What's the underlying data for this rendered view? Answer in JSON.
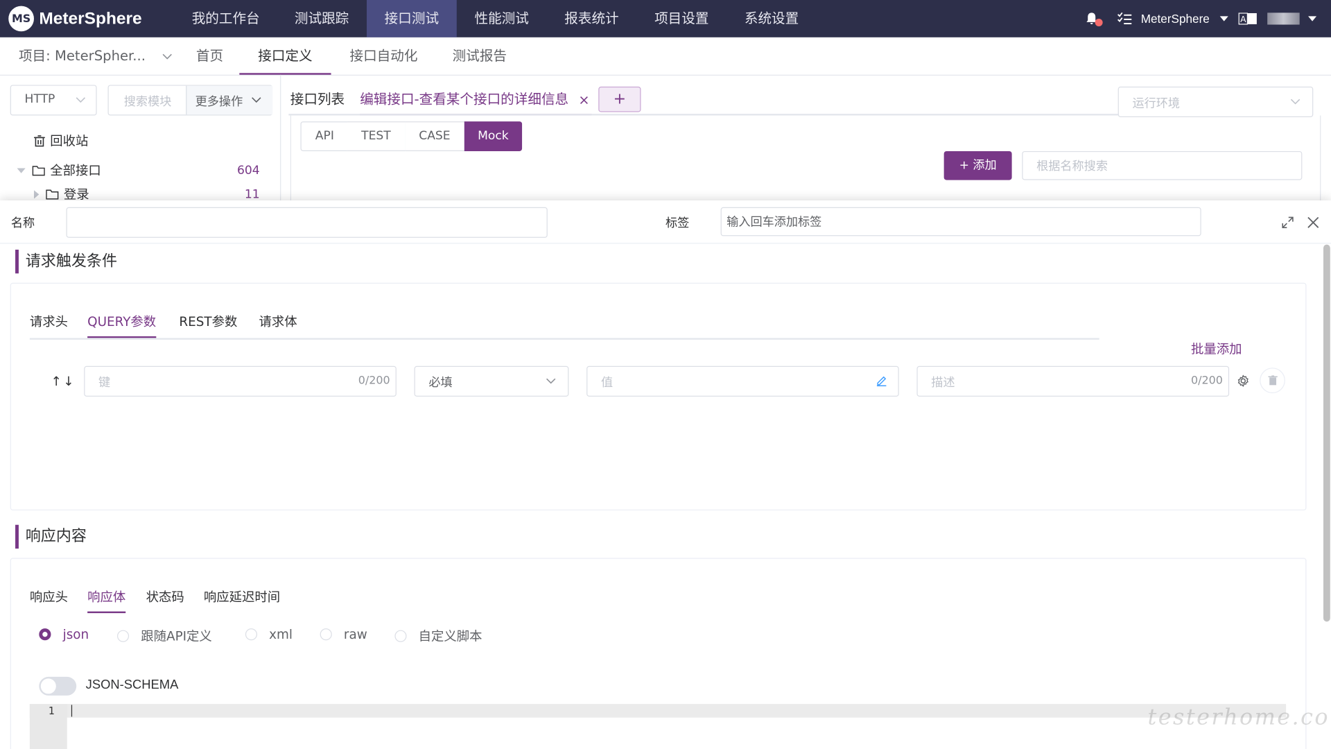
{
  "app": {
    "name": "MeterSphere",
    "logo_glyph": "MS"
  },
  "topnav": {
    "items": [
      "我的工作台",
      "测试跟踪",
      "接口测试",
      "性能测试",
      "报表统计",
      "项目设置",
      "系统设置"
    ],
    "active": "接口测试",
    "user": "MeterSphere"
  },
  "subnav": {
    "project": "项目: MeterSpher...",
    "items": [
      "首页",
      "接口定义",
      "接口自动化",
      "测试报告"
    ],
    "active": "接口定义"
  },
  "left": {
    "protocol": "HTTP",
    "search_placeholder": "搜索模块",
    "more": "更多操作",
    "recycle": "回收站",
    "tree": [
      {
        "label": "全部接口",
        "count": "604"
      },
      {
        "label": "登录",
        "count": "11"
      }
    ]
  },
  "tabs": {
    "list": "接口列表",
    "edit": "编辑接口-查看某个接口的详细信息",
    "add": "+"
  },
  "env_placeholder": "运行环境",
  "segments": [
    "API",
    "TEST",
    "CASE",
    "Mock"
  ],
  "segment_active": "Mock",
  "add_button": "+ 添加",
  "name_search_placeholder": "根据名称搜索",
  "drawer": {
    "name_label": "名称",
    "tag_label": "标签",
    "tag_placeholder": "输入回车添加标签"
  },
  "request": {
    "title": "请求触发条件",
    "tabs": [
      "请求头",
      "QUERY参数",
      "REST参数",
      "请求体"
    ],
    "active": "QUERY参数",
    "batch_add": "批量添加",
    "key_placeholder": "键",
    "key_count": "0/200",
    "required": "必填",
    "value_placeholder": "值",
    "desc_placeholder": "描述",
    "desc_count": "0/200",
    "sort_arrows": "↑↓"
  },
  "response": {
    "title": "响应内容",
    "tabs": [
      "响应头",
      "响应体",
      "状态码",
      "响应延迟时间"
    ],
    "active": "响应体",
    "radios": [
      "json",
      "跟随API定义",
      "xml",
      "raw",
      "自定义脚本"
    ],
    "radio_selected": "json",
    "schema_label": "JSON-SCHEMA",
    "line_no": "1"
  },
  "watermark": "testerhome.com",
  "colors": {
    "nav_bg": "#2d2f4a",
    "accent": "#783887",
    "nav_active": "#4a4d82"
  }
}
